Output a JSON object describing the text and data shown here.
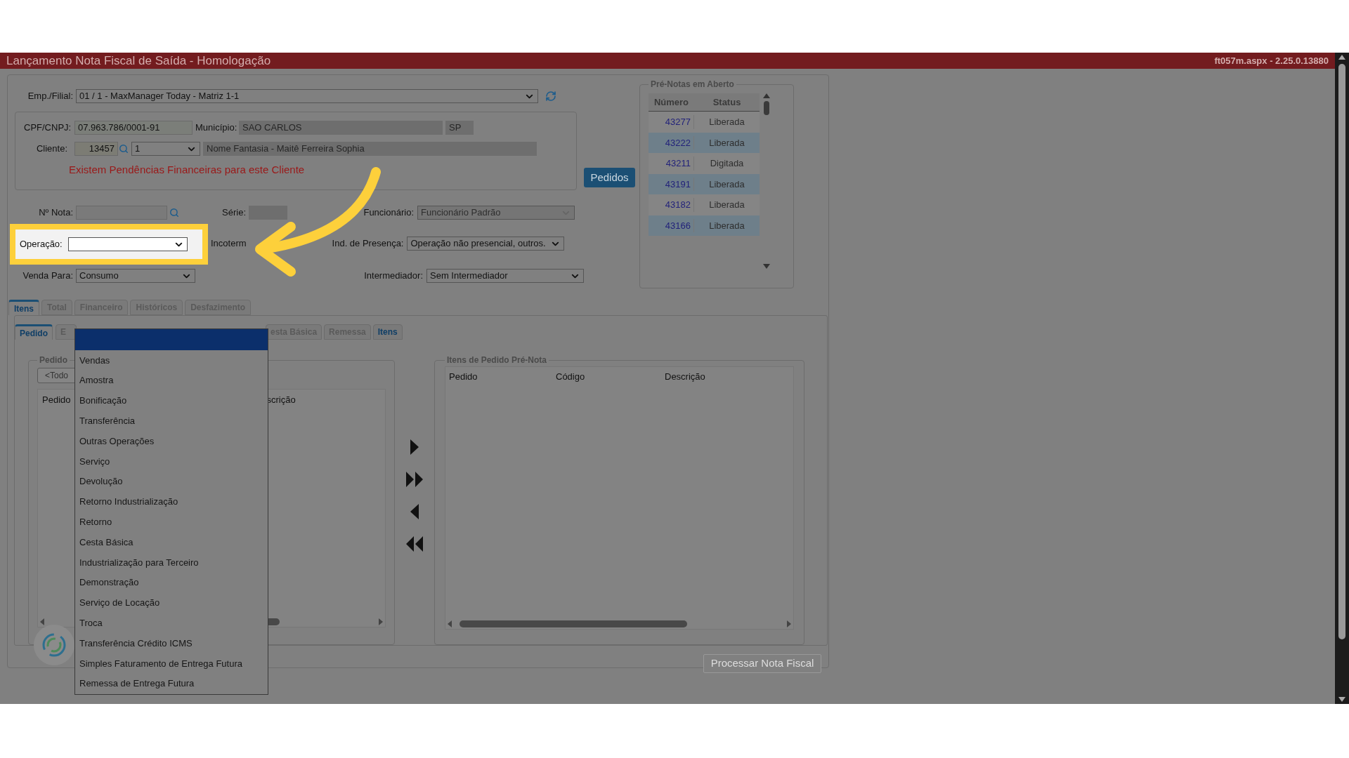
{
  "header": {
    "title": "Lançamento Nota Fiscal de Saída - Homologação",
    "version": "ft057m.aspx - 2.25.0.13880"
  },
  "form": {
    "emp_filial": {
      "label": "Emp./Filial:",
      "value": "01 / 1 - MaxManager Today - Matriz 1-1"
    },
    "cpf_cnpj": {
      "label": "CPF/CNPJ:",
      "value": "07.963.786/0001-91"
    },
    "municipio": {
      "label": "Município:",
      "value": "SAO CARLOS",
      "uf": "SP"
    },
    "cliente": {
      "label": "Cliente:",
      "code": "13457",
      "store": "1",
      "name": "Nome Fantasia - Maitê Ferreira Sophia"
    },
    "warning": "Existem Pendências Financeiras para este Cliente",
    "pedidos_button": "Pedidos",
    "nota": {
      "label": "Nº Nota:"
    },
    "serie": {
      "label": "Série:"
    },
    "funcionario": {
      "label": "Funcionário:",
      "value": "Funcionário Padrão",
      "disabled": true
    },
    "operacao": {
      "label": "Operação:",
      "highlighted": true
    },
    "incoterm": {
      "label": "Incoterm"
    },
    "ind_presenca": {
      "label": "Ind. de Presença:",
      "value": "Operação não presencial, outros."
    },
    "venda_para": {
      "label": "Venda Para:",
      "value": "Consumo"
    },
    "intermediador": {
      "label": "Intermediador:",
      "value": "Sem Intermediador"
    }
  },
  "pre_notas": {
    "title": "Pré-Notas em Aberto",
    "columns": [
      "Número",
      "Status"
    ],
    "rows": [
      {
        "numero": "43277",
        "status": "Liberada"
      },
      {
        "numero": "43222",
        "status": "Liberada"
      },
      {
        "numero": "43211",
        "status": "Digitada"
      },
      {
        "numero": "43191",
        "status": "Liberada"
      },
      {
        "numero": "43182",
        "status": "Liberada"
      },
      {
        "numero": "43166",
        "status": "Liberada"
      }
    ]
  },
  "tabs": [
    {
      "label": "Itens",
      "selected": true
    },
    {
      "label": "Total",
      "selected": false
    },
    {
      "label": "Financeiro",
      "selected": false
    },
    {
      "label": "Históricos",
      "selected": false
    },
    {
      "label": "Desfazimento",
      "selected": false
    }
  ],
  "subtabs": [
    {
      "label": "Pedido",
      "selected": true,
      "accent": true
    },
    {
      "label": "E",
      "selected": false,
      "accent": false
    },
    {
      "label": "esta Básica",
      "selected": false,
      "accent": false
    },
    {
      "label": "Remessa",
      "selected": false,
      "accent": false
    },
    {
      "label": "Itens",
      "selected": false,
      "accent": true
    }
  ],
  "pedidos_panel": {
    "title": "Pedido",
    "filter": "<Todo",
    "columns": [
      "Pedido",
      "scrição"
    ]
  },
  "itens_panel": {
    "title": "Itens de Pedido Pré-Nota",
    "columns": [
      "Pedido",
      "Código",
      "Descrição"
    ]
  },
  "process_button": {
    "label": "Processar Nota Fiscal",
    "disabled": true
  },
  "dropdown": {
    "blank_selected": true,
    "options": [
      {
        "label": "Vendas",
        "selected": false
      },
      {
        "label": "Amostra",
        "selected": false
      },
      {
        "label": "Bonificação",
        "selected": false
      },
      {
        "label": "Transferência",
        "selected": false
      },
      {
        "label": "Outras Operações",
        "selected": false
      },
      {
        "label": "Serviço",
        "selected": false
      },
      {
        "label": "Devolução",
        "selected": false
      },
      {
        "label": "Retorno Industrialização",
        "selected": false
      },
      {
        "label": "Retorno",
        "selected": false
      },
      {
        "label": "Cesta Básica",
        "selected": false
      },
      {
        "label": "Industrialização para Terceiro",
        "selected": false
      },
      {
        "label": "Demonstração",
        "selected": false
      },
      {
        "label": "Serviço de Locação",
        "selected": false
      },
      {
        "label": "Troca",
        "selected": false
      },
      {
        "label": "Transferência Crédito ICMS",
        "selected": false
      },
      {
        "label": "Simples Faturamento de Entrega Futura",
        "selected": false
      },
      {
        "label": "Remessa de Entrega Futura",
        "selected": false
      }
    ]
  }
}
